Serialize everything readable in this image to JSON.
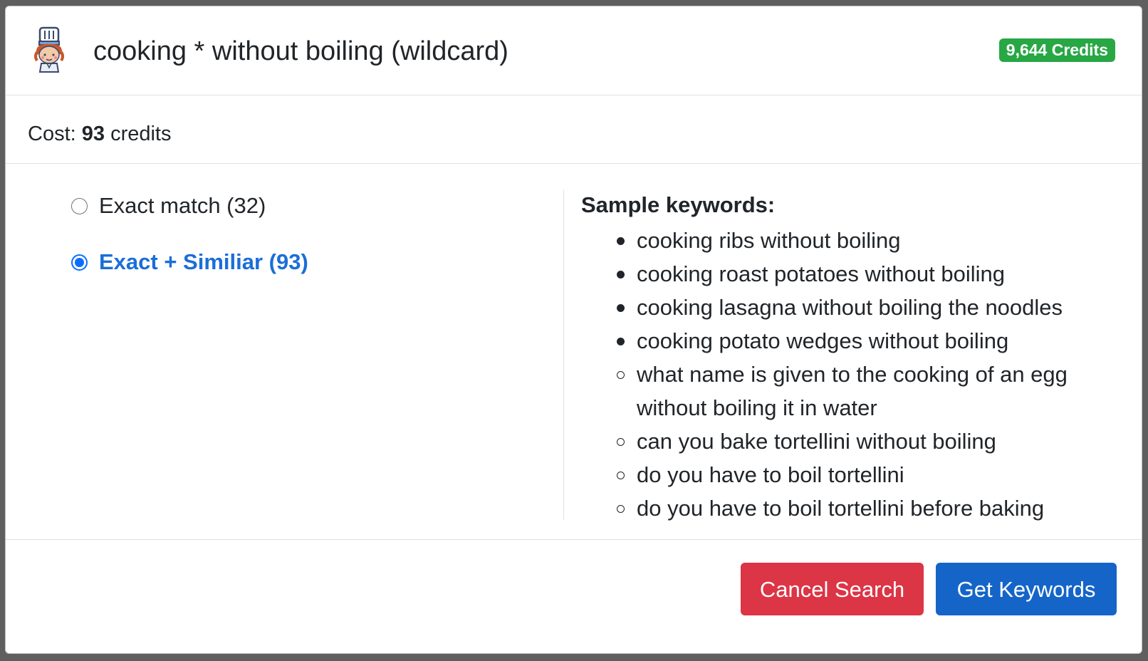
{
  "header": {
    "title": "cooking * without boiling (wildcard)",
    "credits_badge": "9,644 Credits",
    "logo_icon": "chef-icon"
  },
  "cost": {
    "prefix": "Cost:",
    "amount": "93",
    "suffix": "credits"
  },
  "options": [
    {
      "label": "Exact match (32)",
      "selected": false
    },
    {
      "label": "Exact + Similiar (93)",
      "selected": true
    }
  ],
  "samples": {
    "heading": "Sample keywords:",
    "items": [
      {
        "text": "cooking ribs without boiling",
        "bullet": "filled"
      },
      {
        "text": "cooking roast potatoes without boiling",
        "bullet": "filled"
      },
      {
        "text": "cooking lasagna without boiling the noodles",
        "bullet": "filled"
      },
      {
        "text": "cooking potato wedges without boiling",
        "bullet": "filled"
      },
      {
        "text": "what name is given to the cooking of an egg without boiling it in water",
        "bullet": "hollow"
      },
      {
        "text": "can you bake tortellini without boiling",
        "bullet": "hollow"
      },
      {
        "text": "do you have to boil tortellini",
        "bullet": "hollow"
      },
      {
        "text": "do you have to boil tortellini before baking",
        "bullet": "hollow"
      }
    ]
  },
  "footer": {
    "cancel_label": "Cancel Search",
    "get_label": "Get Keywords"
  },
  "colors": {
    "badge": "#28a745",
    "cancel": "#dc3545",
    "primary": "#1565c8",
    "active_option": "#1a6ed8"
  }
}
